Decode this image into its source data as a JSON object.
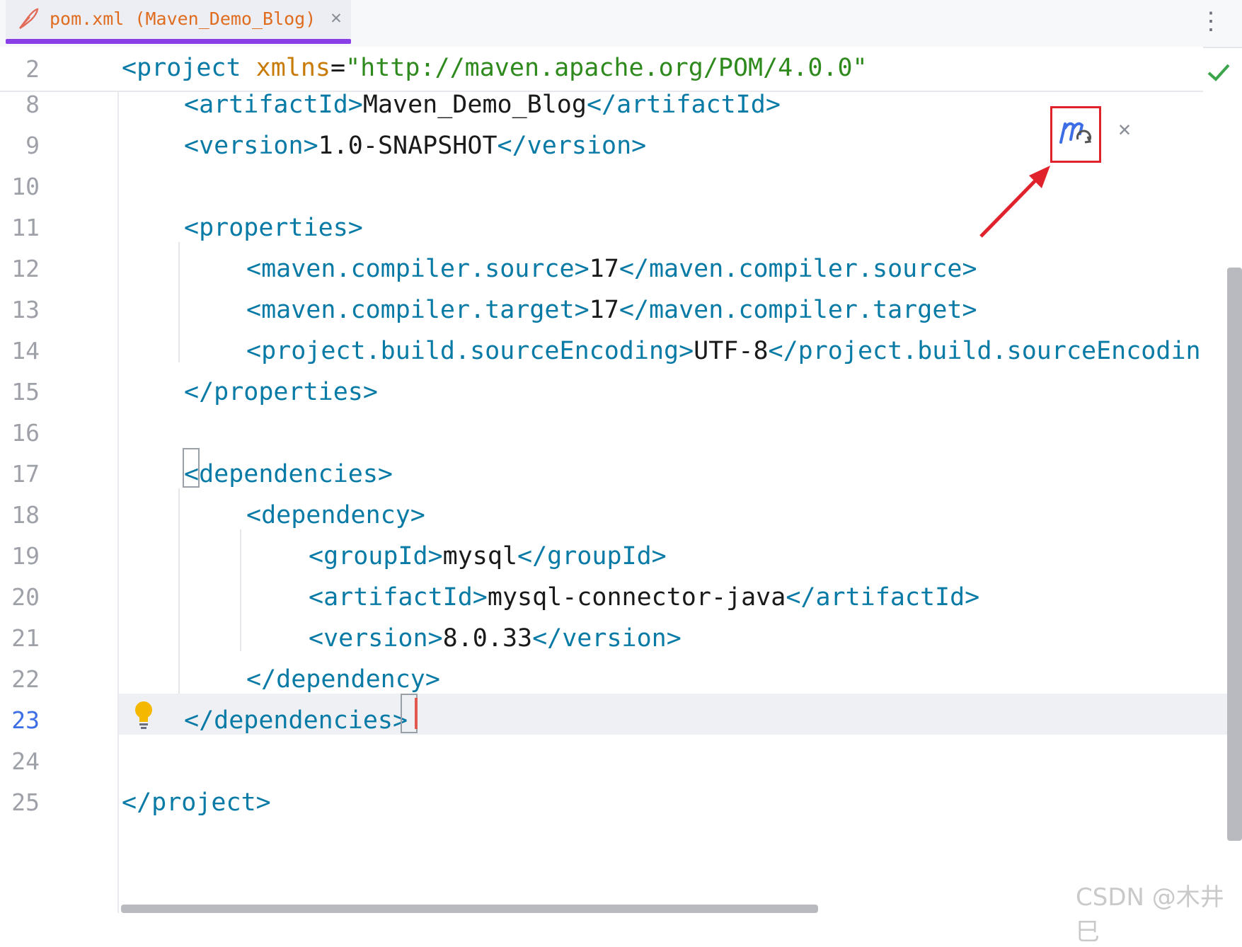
{
  "tab": {
    "title": "pom.xml (Maven_Demo_Blog)",
    "file_icon": "feather-icon",
    "close_glyph": "✕"
  },
  "menu": {
    "glyph": "⋮"
  },
  "sticky_line": {
    "number": "2",
    "open": "<project",
    "attr": " xmlns",
    "eq": "=",
    "value": "\"http://maven.apache.org/POM/4.0.0\""
  },
  "lines": [
    {
      "number": "8",
      "indent": 1,
      "open": "<artifactId>",
      "text": "Maven_Demo_Blog",
      "close": "</artifactId>"
    },
    {
      "number": "9",
      "indent": 1,
      "open": "<version>",
      "text": "1.0-SNAPSHOT",
      "close": "</version>"
    },
    {
      "number": "10",
      "indent": 0,
      "open": "",
      "text": "",
      "close": ""
    },
    {
      "number": "11",
      "indent": 1,
      "open": "<properties>",
      "text": "",
      "close": ""
    },
    {
      "number": "12",
      "indent": 2,
      "open": "<maven.compiler.source>",
      "text": "17",
      "close": "</maven.compiler.source>"
    },
    {
      "number": "13",
      "indent": 2,
      "open": "<maven.compiler.target>",
      "text": "17",
      "close": "</maven.compiler.target>"
    },
    {
      "number": "14",
      "indent": 2,
      "open": "<project.build.sourceEncoding>",
      "text": "UTF-8",
      "close": "</project.build.sourceEncodin"
    },
    {
      "number": "15",
      "indent": 1,
      "open": "</properties>",
      "text": "",
      "close": ""
    },
    {
      "number": "16",
      "indent": 0,
      "open": "",
      "text": "",
      "close": ""
    },
    {
      "number": "17",
      "indent": 1,
      "open": "<dependencies>",
      "text": "",
      "close": ""
    },
    {
      "number": "18",
      "indent": 2,
      "open": "<dependency>",
      "text": "",
      "close": ""
    },
    {
      "number": "19",
      "indent": 3,
      "open": "<groupId>",
      "text": "mysql",
      "close": "</groupId>"
    },
    {
      "number": "20",
      "indent": 3,
      "open": "<artifactId>",
      "text": "mysql-connector-java",
      "close": "</artifactId>"
    },
    {
      "number": "21",
      "indent": 3,
      "open": "<version>",
      "text": "8.0.33",
      "close": "</version>"
    },
    {
      "number": "22",
      "indent": 2,
      "open": "</dependency>",
      "text": "",
      "close": ""
    },
    {
      "number": "23",
      "indent": 1,
      "open": "</dependencies>",
      "text": "",
      "close": "",
      "active": true
    },
    {
      "number": "24",
      "indent": 0,
      "open": "",
      "text": "",
      "close": ""
    },
    {
      "number": "25",
      "indent": 0,
      "open": "</project>",
      "text": "",
      "close": ""
    }
  ],
  "maven_reload": {
    "icon": "maven-reload-icon",
    "close_glyph": "✕"
  },
  "status": {
    "icon": "checkmark-icon"
  },
  "watermark": "CSDN @木井巳",
  "colors": {
    "tag": "#087aa6",
    "text": "#1a1a1a",
    "attr": "#c97b08",
    "string": "#2f8a1e",
    "tab_accent": "#8a3fe6",
    "highlight_box": "#e0222c"
  }
}
